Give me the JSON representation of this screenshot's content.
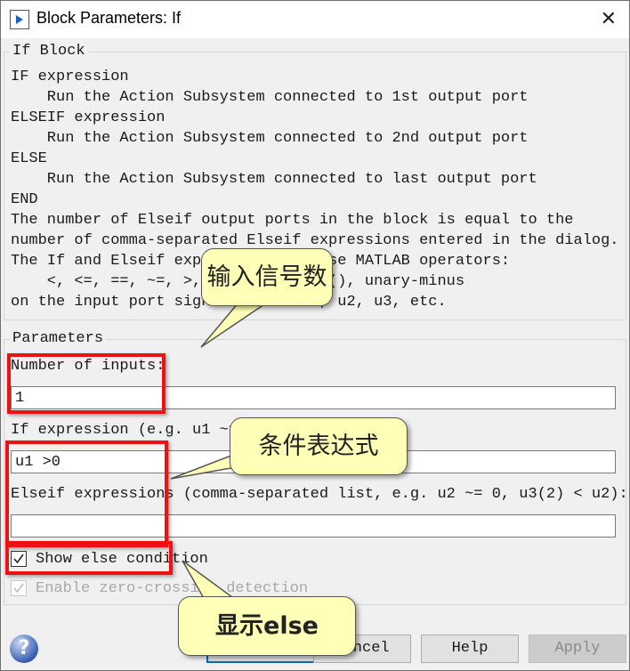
{
  "window": {
    "title": "Block Parameters: If",
    "close_icon": "close-icon"
  },
  "description_group": {
    "title": "If Block",
    "lines": [
      "IF expression",
      "    Run the Action Subsystem connected to 1st output port",
      "ELSEIF expression",
      "    Run the Action Subsystem connected to 2nd output port",
      "ELSE",
      "    Run the Action Subsystem connected to last output port",
      "END",
      "The number of Elseif output ports in the block is equal to the",
      "number of comma-separated Elseif expressions entered in the dialog.",
      "The If and Elseif expressions can use MATLAB operators:",
      "    <, <=, ==, ~=, >, >=, &, |, ~, (), unary-minus",
      "on the input port signals named u1, u2, u3, etc."
    ]
  },
  "parameters": {
    "title": "Parameters",
    "num_inputs_label": "Number of inputs:",
    "num_inputs_value": "1",
    "if_expr_label": "If expression (e.g. u1 ~= 0):",
    "if_expr_value": "u1 >0",
    "elseif_label": "Elseif expressions (comma-separated list, e.g. u2 ~= 0, u3(2) < u2):",
    "elseif_value": "",
    "show_else_label": "Show else condition",
    "show_else_checked": true,
    "zero_cross_label": "Enable zero-crossing detection",
    "zero_cross_checked": true,
    "zero_cross_enabled": false
  },
  "buttons": {
    "ok": "OK",
    "cancel": "Cancel",
    "help": "Help",
    "apply": "Apply",
    "apply_enabled": false
  },
  "annotations": {
    "callout1": "输入信号数",
    "callout2": "条件表达式",
    "callout3": "显示else",
    "highlight_color": "#ee1111",
    "callout_color": "#ffffb8"
  }
}
